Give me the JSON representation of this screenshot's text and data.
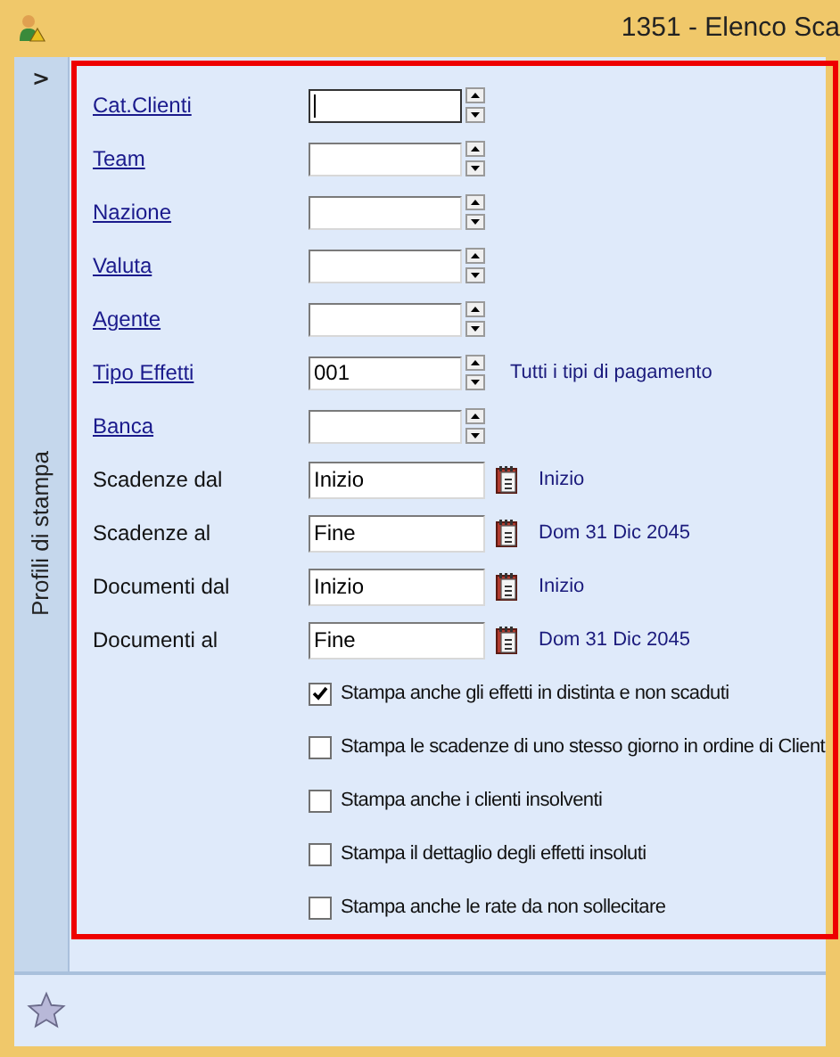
{
  "window": {
    "title": "1351 - Elenco Sca"
  },
  "sidebar": {
    "toggle": ">",
    "label": "Profili di stampa"
  },
  "fields": [
    {
      "kind": "lookup",
      "label": "Cat.Clienti",
      "link": true,
      "focused": true
    },
    {
      "kind": "lookup",
      "label": "Team",
      "link": true,
      "focused": false
    },
    {
      "kind": "lookup",
      "label": "Nazione",
      "link": true,
      "focused": false
    },
    {
      "kind": "lookup",
      "label": "Valuta",
      "link": true,
      "focused": false
    },
    {
      "kind": "lookup",
      "label": "Agente",
      "link": true,
      "focused": false
    },
    {
      "kind": "lookup",
      "label": "Tipo Effetti",
      "link": true,
      "value": "001",
      "focused": false,
      "hint": "Tutti i tipi di pagamento"
    },
    {
      "kind": "lookup",
      "label": "Banca",
      "link": true,
      "focused": false
    },
    {
      "kind": "date",
      "label": "Scadenze dal",
      "link": false,
      "value": "Inizio",
      "hint": "Inizio"
    },
    {
      "kind": "date",
      "label": "Scadenze al",
      "link": false,
      "value": "Fine",
      "hint": "Dom 31 Dic 2045"
    },
    {
      "kind": "date",
      "label": "Documenti dal",
      "link": false,
      "value": "Inizio",
      "hint": "Inizio"
    },
    {
      "kind": "date",
      "label": "Documenti al",
      "link": false,
      "value": "Fine",
      "hint": "Dom 31 Dic 2045"
    }
  ],
  "options": [
    {
      "label": "Stampa anche gli effetti in distinta e non scaduti",
      "checked": true
    },
    {
      "label": "Stampa le scadenze di uno stesso giorno in ordine di Client",
      "checked": false
    },
    {
      "label": "Stampa anche i clienti insolventi",
      "checked": false
    },
    {
      "label": "Stampa il dettaglio degli effetti insoluti",
      "checked": false
    },
    {
      "label": "Stampa anche le rate da non sollecitare",
      "checked": false
    }
  ]
}
